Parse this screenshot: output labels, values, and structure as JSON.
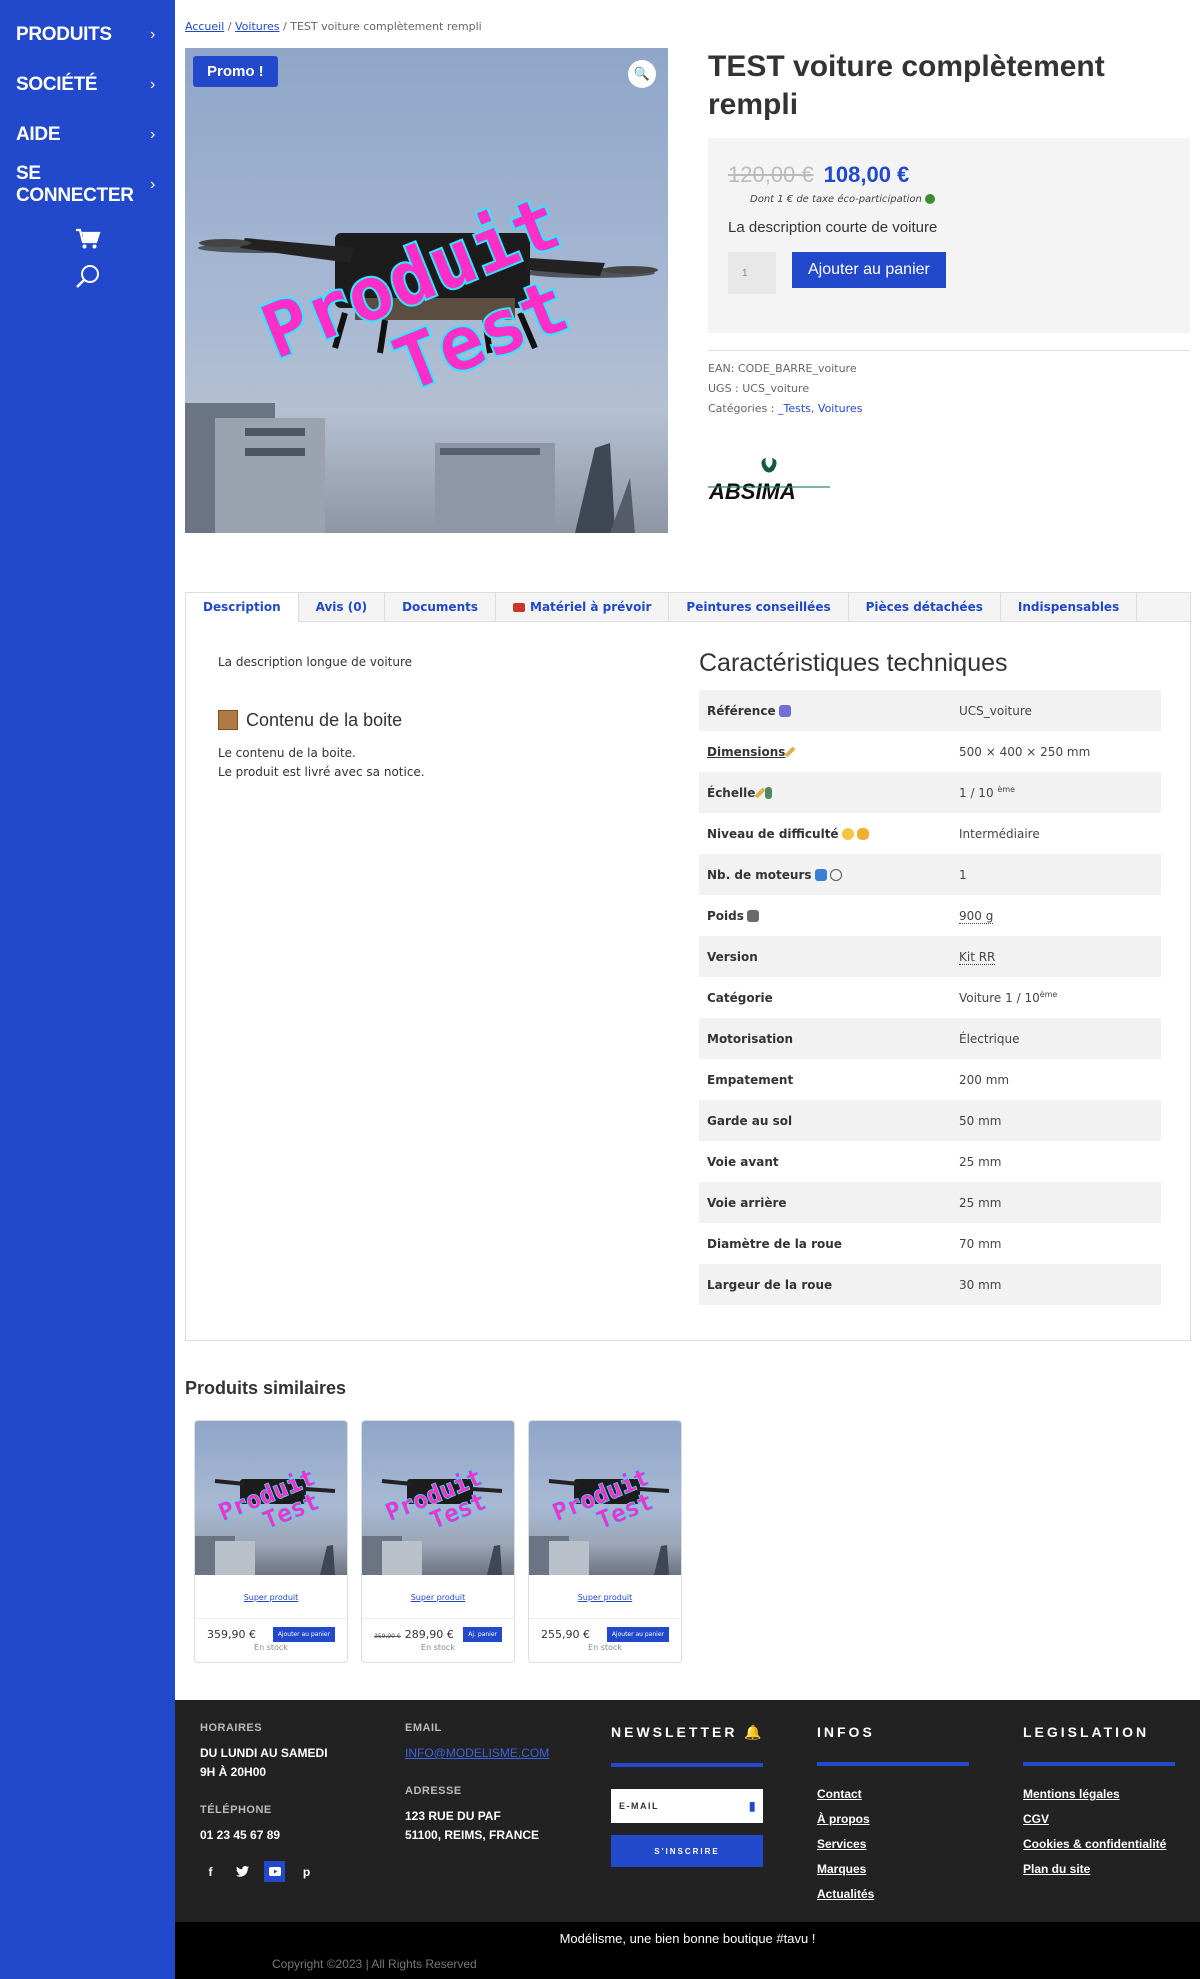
{
  "sidebar": {
    "items": [
      {
        "label": "PRODUITS"
      },
      {
        "label": "SOCIÉTÉ"
      },
      {
        "label": "AIDE"
      },
      {
        "label": "SE CONNECTER"
      }
    ],
    "chevron": "›"
  },
  "breadcrumb": {
    "home": "Accueil",
    "sep1": " / ",
    "category": "Voitures",
    "sep2": " / ",
    "current": "TEST voiture complètement rempli"
  },
  "product": {
    "image_text_line1": "Produit",
    "image_text_line2": "Test",
    "promo_badge": "Promo !",
    "zoom_icon": "🔍",
    "title": "TEST voiture complètement rempli",
    "price_old": "120,00 €",
    "price_new": "108,00 €",
    "eco_tax": "Dont 1 € de taxe éco-participation",
    "short_description": "La description courte de voiture",
    "qty": "1",
    "add_to_cart": "Ajouter au panier",
    "meta": {
      "ean": "EAN: CODE_BARRE_voiture",
      "sku": "UGS : UCS_voiture",
      "categories_label": "Catégories : ",
      "category_1": "_Tests",
      "category_sep": ", ",
      "category_2": "Voitures"
    },
    "brand": "ABSIMA"
  },
  "tabs": [
    {
      "label": "Description"
    },
    {
      "label": "Avis (0)"
    },
    {
      "label": "Documents"
    },
    {
      "label": "Matériel à prévoir"
    },
    {
      "label": "Peintures conseillées"
    },
    {
      "label": "Pièces détachées"
    },
    {
      "label": "Indispensables"
    }
  ],
  "description": {
    "long": "La description longue de voiture",
    "box_title": "Contenu de la boite",
    "box_line1": "Le contenu de la boite.",
    "box_line2": "Le produit est livré avec sa notice."
  },
  "specs": {
    "title": "Caractéristiques techniques",
    "rows": [
      {
        "label": "Référence",
        "value": "UCS_voiture"
      },
      {
        "label": "Dimensions",
        "value": "500 × 400 × 250 mm"
      },
      {
        "label": "Échelle",
        "value": "1 / 10",
        "sup": "ème"
      },
      {
        "label": "Niveau de difficulté",
        "value": "Intermédiaire"
      },
      {
        "label": "Nb. de moteurs",
        "value": "1"
      },
      {
        "label": "Poids",
        "value": "900 g"
      },
      {
        "label": "Version",
        "value": "Kit RR"
      },
      {
        "label": "Catégorie",
        "value": "Voiture 1 / 10",
        "sup": "ème"
      },
      {
        "label": "Motorisation",
        "value": "Électrique"
      },
      {
        "label": "Empatement",
        "value": "200 mm"
      },
      {
        "label": "Garde au sol",
        "value": "50 mm"
      },
      {
        "label": "Voie avant",
        "value": "25 mm"
      },
      {
        "label": "Voie arrière",
        "value": "25 mm"
      },
      {
        "label": "Diamètre de la roue",
        "value": "70 mm"
      },
      {
        "label": "Largeur de la roue",
        "value": "30 mm"
      }
    ]
  },
  "related": {
    "title": "Produits similaires",
    "cards": [
      {
        "name": "Super produit",
        "price": "359,90 €",
        "old_price": "",
        "button": "Ajouter au panier",
        "stock": "En stock"
      },
      {
        "name": "Super produit",
        "price": "289,90 €",
        "old_price": "359,90 €",
        "button": "Aj. panier",
        "stock": "En stock"
      },
      {
        "name": "Super produit",
        "price": "255,90 €",
        "old_price": "",
        "button": "Ajouter au panier",
        "stock": "En stock"
      }
    ]
  },
  "footer": {
    "hours_label": "Horaires",
    "hours_line1": "Du lundi au samedi",
    "hours_line2": "9h à 20h00",
    "phone_label": "Téléphone",
    "phone": "01 23 45 67 89",
    "email_label": "Email",
    "email": "INFO@MODELISME.COM",
    "address_label": "Adresse",
    "address_line1": "123 RUE DU PAF",
    "address_line2": "51100, REIMS, FRANCE",
    "newsletter_title": "NEWSLETTER",
    "email_placeholder": "E-MAIL",
    "subscribe": "S'INSCRIRE",
    "infos_title": "INFOS",
    "infos_links": [
      "Contact",
      "À propos",
      "Services",
      "Marques",
      "Actualités"
    ],
    "legal_title": "LEGISLATION",
    "legal_links": [
      "Mentions légales",
      "CGV",
      "Cookies & confidentialité",
      "Plan du site"
    ],
    "socials": [
      "f",
      "t",
      "▶",
      "p"
    ],
    "slogan": "Modélisme, une bien bonne boutique #tavu !",
    "copyright": "Copyright ©2023 | All Rights Reserved"
  },
  "colors": {
    "primary": "#2249cc",
    "footer_bg": "#222222",
    "promo_text": "#ff2ec7",
    "promo_glow": "#2ee8ff"
  }
}
